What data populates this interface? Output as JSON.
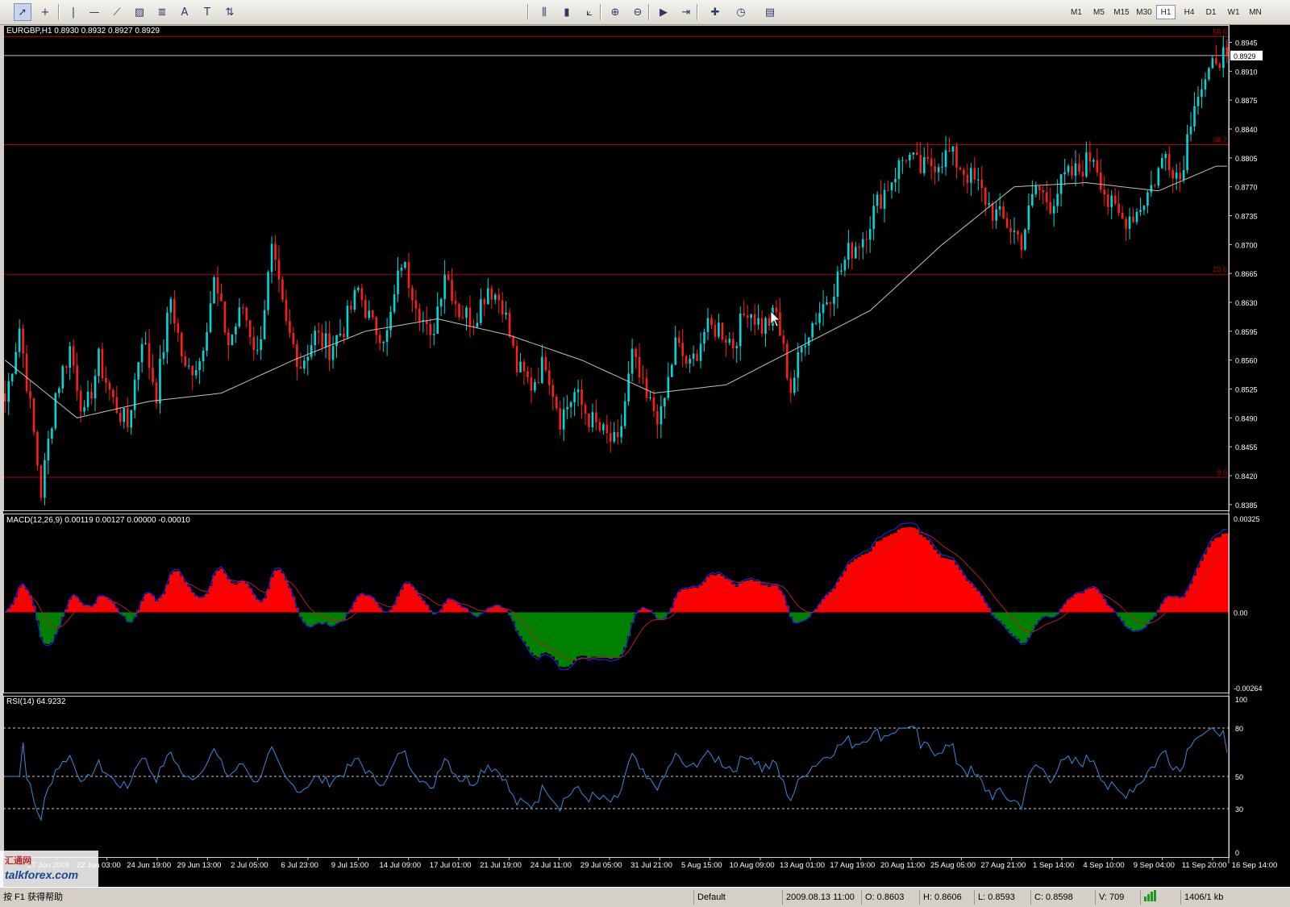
{
  "toolbar": {
    "tools": [
      {
        "icon": "cursor-icon",
        "glyph": "➚",
        "active": true
      },
      {
        "icon": "crosshair-icon",
        "glyph": "+"
      },
      {
        "icon": "vertical-line-icon",
        "glyph": "|"
      },
      {
        "icon": "horizontal-line-icon",
        "glyph": "—"
      },
      {
        "icon": "trendline-icon",
        "glyph": "⟋"
      },
      {
        "icon": "equidistant-channel-icon",
        "glyph": "▨"
      },
      {
        "icon": "fibonacci-retracement-icon",
        "glyph": "≣"
      },
      {
        "icon": "text-icon",
        "glyph": "A"
      },
      {
        "icon": "text-label-icon",
        "glyph": "T"
      },
      {
        "icon": "arrows-icon",
        "glyph": "⇅"
      },
      {
        "icon": "bar-chart-icon",
        "glyph": "⫼"
      },
      {
        "icon": "candlesticks-icon",
        "glyph": "▮"
      },
      {
        "icon": "line-chart-icon",
        "glyph": "⟀"
      },
      {
        "icon": "zoom-in-icon",
        "glyph": "⊕"
      },
      {
        "icon": "zoom-out-icon",
        "glyph": "⊖"
      },
      {
        "icon": "auto-scroll-icon",
        "glyph": "▶"
      },
      {
        "icon": "chart-shift-icon",
        "glyph": "⇥"
      },
      {
        "icon": "indicators-icon",
        "glyph": "✚"
      },
      {
        "icon": "periods-icon",
        "glyph": "◷"
      },
      {
        "icon": "templates-icon",
        "glyph": "▤"
      }
    ],
    "timeframes": [
      "M1",
      "M5",
      "M15",
      "M30",
      "H1",
      "H4",
      "D1",
      "W1",
      "MN"
    ],
    "active_timeframe": "H1"
  },
  "main_chart": {
    "title": "EURGBP,H1  0.8930 0.8932 0.8927 0.8929",
    "current_price": "0.8929",
    "price_axis": [
      "0.8945",
      "0.8910",
      "0.8875",
      "0.8840",
      "0.8805",
      "0.8770",
      "0.8735",
      "0.8700",
      "0.8665",
      "0.8630",
      "0.8595",
      "0.8560",
      "0.8525",
      "0.8490",
      "0.8455",
      "0.8420",
      "0.8385"
    ],
    "fibo_levels": [
      {
        "label": "50.0",
        "price": 0.8952
      },
      {
        "label": "38.2",
        "price": 0.8821
      },
      {
        "label": "23.6",
        "price": 0.8664
      },
      {
        "label": "0.0",
        "price": 0.8418
      }
    ],
    "colors": {
      "bull": "#00d8d8",
      "bear": "#ff1e1e",
      "fibo": "#b00000",
      "ma": "#c0c0c0",
      "price_line": "#c0c0c0"
    }
  },
  "macd": {
    "title": "MACD(12,26,9) 0.00119 0.00127 0.00000 -0.00010",
    "axis": [
      "0.00325",
      "0.00",
      "-0.00264"
    ],
    "colors": {
      "up": "#ff0000",
      "down": "#008000",
      "main": "#2020e0",
      "signal": "#b02020"
    }
  },
  "rsi": {
    "title": "RSI(14) 64.9232",
    "axis": [
      "100",
      "80",
      "50",
      "30",
      "0"
    ],
    "levels": [
      80,
      50,
      30
    ],
    "color": "#3a8ae0"
  },
  "time_axis": [
    "17 Jun 2009",
    "22 Jun 03:00",
    "24 Jun 19:00",
    "29 Jun 13:00",
    "2 Jul 05:00",
    "6 Jul 23:00",
    "9 Jul 15:00",
    "14 Jul 09:00",
    "17 Jul 01:00",
    "21 Jul 19:00",
    "24 Jul 11:00",
    "29 Jul 05:00",
    "31 Jul 21:00",
    "5 Aug 15:00",
    "10 Aug 09:00",
    "13 Aug 01:00",
    "17 Aug 19:00",
    "20 Aug 11:00",
    "25 Aug 05:00",
    "27 Aug 21:00",
    "1 Sep 14:00",
    "4 Sep 10:00",
    "9 Sep 04:00",
    "11 Sep 20:00",
    "16 Sep 14:00"
  ],
  "chart_data": {
    "type": "candlestick",
    "symbol": "EURGBP",
    "timeframe": "H1",
    "title": "EURGBP,H1  0.8930 0.8932 0.8927 0.8929",
    "ohlc_last": {
      "open": 0.893,
      "high": 0.8932,
      "low": 0.8927,
      "close": 0.8929
    },
    "ylim": [
      0.8378,
      0.8966
    ],
    "x_tick_labels": [
      "17 Jun 2009",
      "22 Jun 03:00",
      "24 Jun 19:00",
      "29 Jun 13:00",
      "2 Jul 05:00",
      "6 Jul 23:00",
      "9 Jul 15:00",
      "14 Jul 09:00",
      "17 Jul 01:00",
      "21 Jul 19:00",
      "24 Jul 11:00",
      "29 Jul 05:00",
      "31 Jul 21:00",
      "5 Aug 15:00",
      "10 Aug 09:00",
      "13 Aug 01:00",
      "17 Aug 19:00",
      "20 Aug 11:00",
      "25 Aug 05:00",
      "27 Aug 21:00",
      "1 Sep 14:00",
      "4 Sep 10:00",
      "9 Sep 04:00",
      "11 Sep 20:00",
      "16 Sep 14:00"
    ],
    "close_path": [
      [
        0,
        0.851
      ],
      [
        4,
        0.86
      ],
      [
        8,
        0.847
      ],
      [
        10,
        0.84
      ],
      [
        14,
        0.852
      ],
      [
        18,
        0.8575
      ],
      [
        22,
        0.849
      ],
      [
        26,
        0.856
      ],
      [
        30,
        0.851
      ],
      [
        34,
        0.848
      ],
      [
        38,
        0.859
      ],
      [
        42,
        0.852
      ],
      [
        46,
        0.8635
      ],
      [
        50,
        0.8545
      ],
      [
        54,
        0.856
      ],
      [
        58,
        0.8655
      ],
      [
        62,
        0.858
      ],
      [
        66,
        0.8625
      ],
      [
        70,
        0.8565
      ],
      [
        74,
        0.869
      ],
      [
        78,
        0.86
      ],
      [
        82,
        0.8555
      ],
      [
        86,
        0.859
      ],
      [
        90,
        0.8575
      ],
      [
        94,
        0.86
      ],
      [
        98,
        0.8645
      ],
      [
        102,
        0.86
      ],
      [
        106,
        0.859
      ],
      [
        110,
        0.868
      ],
      [
        114,
        0.8635
      ],
      [
        118,
        0.858
      ],
      [
        122,
        0.867
      ],
      [
        126,
        0.862
      ],
      [
        130,
        0.861
      ],
      [
        134,
        0.865
      ],
      [
        138,
        0.863
      ],
      [
        142,
        0.855
      ],
      [
        146,
        0.853
      ],
      [
        150,
        0.856
      ],
      [
        154,
        0.849
      ],
      [
        158,
        0.852
      ],
      [
        162,
        0.849
      ],
      [
        166,
        0.847
      ],
      [
        170,
        0.8455
      ],
      [
        174,
        0.8565
      ],
      [
        178,
        0.851
      ],
      [
        182,
        0.849
      ],
      [
        186,
        0.858
      ],
      [
        190,
        0.855
      ],
      [
        194,
        0.8595
      ],
      [
        198,
        0.86
      ],
      [
        202,
        0.858
      ],
      [
        206,
        0.8625
      ],
      [
        210,
        0.86
      ],
      [
        214,
        0.8615
      ],
      [
        218,
        0.8525
      ],
      [
        222,
        0.859
      ],
      [
        226,
        0.862
      ],
      [
        230,
        0.865
      ],
      [
        234,
        0.869
      ],
      [
        238,
        0.871
      ],
      [
        242,
        0.875
      ],
      [
        246,
        0.878
      ],
      [
        250,
        0.881
      ],
      [
        254,
        0.879
      ],
      [
        258,
        0.88
      ],
      [
        262,
        0.881
      ],
      [
        266,
        0.879
      ],
      [
        270,
        0.877
      ],
      [
        274,
        0.874
      ],
      [
        278,
        0.8725
      ],
      [
        282,
        0.8705
      ],
      [
        286,
        0.877
      ],
      [
        290,
        0.875
      ],
      [
        294,
        0.878
      ],
      [
        298,
        0.879
      ],
      [
        302,
        0.881
      ],
      [
        306,
        0.875
      ],
      [
        310,
        0.873
      ],
      [
        314,
        0.874
      ],
      [
        318,
        0.877
      ],
      [
        322,
        0.881
      ],
      [
        326,
        0.878
      ],
      [
        330,
        0.888
      ],
      [
        334,
        0.89
      ],
      [
        336,
        0.8929
      ]
    ],
    "ma_path": [
      [
        0,
        0.856
      ],
      [
        20,
        0.849
      ],
      [
        40,
        0.851
      ],
      [
        60,
        0.852
      ],
      [
        80,
        0.856
      ],
      [
        100,
        0.8595
      ],
      [
        120,
        0.861
      ],
      [
        140,
        0.859
      ],
      [
        160,
        0.856
      ],
      [
        180,
        0.852
      ],
      [
        200,
        0.853
      ],
      [
        220,
        0.8575
      ],
      [
        240,
        0.862
      ],
      [
        260,
        0.87
      ],
      [
        280,
        0.877
      ],
      [
        300,
        0.8775
      ],
      [
        320,
        0.8765
      ],
      [
        336,
        0.8795
      ]
    ],
    "macd_range": [
      -0.00264,
      0.00325
    ],
    "rsi_levels": [
      30,
      50,
      80
    ],
    "rsi_current": 64.9232
  },
  "status": {
    "help": "按 F1 获得帮助",
    "profile": "Default",
    "datetime": "2009.08.13 11:00",
    "open": "O: 0.8603",
    "high": "H: 0.8606",
    "low": "L: 0.8593",
    "close": "C: 0.8598",
    "volume": "V: 709",
    "traffic": "1406/1 kb"
  },
  "watermark": {
    "text": "talkforex.com",
    "cn": "汇通网"
  }
}
